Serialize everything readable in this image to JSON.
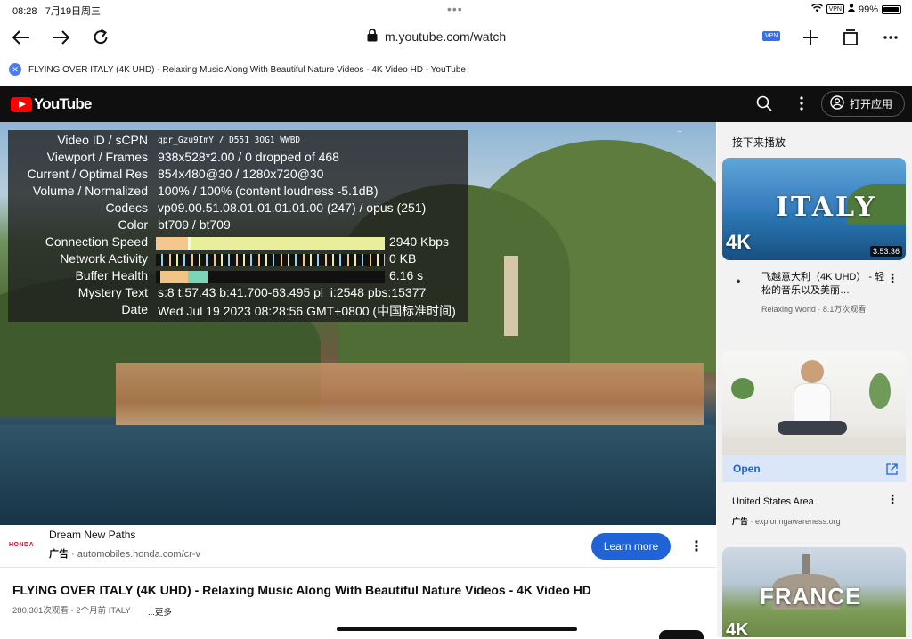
{
  "status_bar": {
    "time": "08:28",
    "date": "7月19日周三",
    "vpn": "VPN",
    "battery": "99%"
  },
  "browser": {
    "url": "m.youtube.com/watch",
    "vpn_label": "VPN",
    "tab_title": "FLYING OVER ITALY (4K UHD) - Relaxing Music Along With Beautiful Nature Videos - 4K Video HD - YouTube"
  },
  "yt_header": {
    "logo_text": "YouTube",
    "open_app_label": "打开应用"
  },
  "stats": [
    {
      "label": "Video ID / sCPN",
      "value": "qpr_Gzu9ImY / D551 3OG1 WWBD"
    },
    {
      "label": "Viewport / Frames",
      "value": "938x528*2.00 / 0 dropped of 468"
    },
    {
      "label": "Current / Optimal Res",
      "value": "854x480@30 / 1280x720@30"
    },
    {
      "label": "Volume / Normalized",
      "value": "100% / 100% (content loudness -5.1dB)"
    },
    {
      "label": "Codecs",
      "value": "vp09.00.51.08.01.01.01.01.00 (247) / opus (251)"
    },
    {
      "label": "Color",
      "value": "bt709 / bt709"
    },
    {
      "label": "Connection Speed",
      "value": "2940 Kbps"
    },
    {
      "label": "Network Activity",
      "value": "0 KB"
    },
    {
      "label": "Buffer Health",
      "value": "6.16 s"
    },
    {
      "label": "Mystery Text",
      "value": "s:8 t:57.43 b:41.700-63.495 pl_i:2548 pbs:15377"
    },
    {
      "label": "Date",
      "value": "Wed Jul 19 2023 08:28:56 GMT+0800 (中国标准时间)"
    }
  ],
  "ad": {
    "brand_logo": "HONDA",
    "title": "Dream New Paths",
    "tag": "广告",
    "url": "automobiles.honda.com/cr-v",
    "cta": "Learn more"
  },
  "video": {
    "title": "FLYING OVER ITALY (4K UHD) - Relaxing Music Along With Beautiful Nature Videos - 4K Video HD",
    "meta": "280,301次观看 · 2个月前 ITALY",
    "more": "...更多"
  },
  "sidebar": {
    "header": "接下来播放",
    "items": [
      {
        "thumb_text": "ITALY",
        "badge": "4K",
        "duration": "3:53:36",
        "title": "飞越意大利（4K UHD） - 轻松的音乐以及美丽…",
        "channel": "Relaxing World · 8.1万次观看"
      },
      {
        "open_label": "Open",
        "title": "United States Area",
        "tag": "广告",
        "channel": "exploringawareness.org"
      },
      {
        "thumb_text": "FRANCE",
        "badge": "4K"
      }
    ]
  },
  "colors": {
    "yt_red": "#ff0000",
    "link_blue": "#1f63d6",
    "header_bg": "#0f0f0f"
  }
}
